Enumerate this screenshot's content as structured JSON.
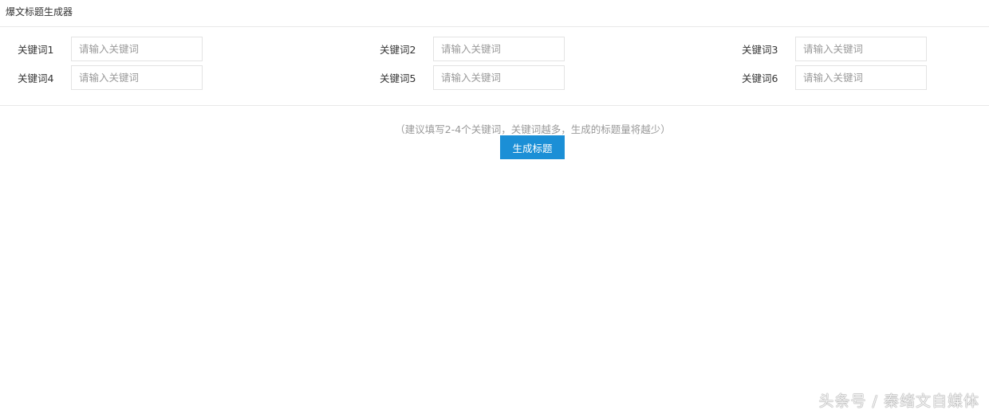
{
  "header": {
    "title": "爆文标题生成器"
  },
  "fields": [
    {
      "label": "关键词1",
      "placeholder": "请输入关键词",
      "value": ""
    },
    {
      "label": "关键词2",
      "placeholder": "请输入关键词",
      "value": ""
    },
    {
      "label": "关键词3",
      "placeholder": "请输入关键词",
      "value": ""
    },
    {
      "label": "关键词4",
      "placeholder": "请输入关键词",
      "value": ""
    },
    {
      "label": "关键词5",
      "placeholder": "请输入关键词",
      "value": ""
    },
    {
      "label": "关键词6",
      "placeholder": "请输入关键词",
      "value": ""
    }
  ],
  "hint": "（建议填写2-4个关键词，关键词越多，生成的标题量将越少）",
  "generate_button": "生成标题",
  "watermark": "头条号 / 秦绪文自媒体",
  "colors": {
    "accent": "#1b8fd6"
  }
}
